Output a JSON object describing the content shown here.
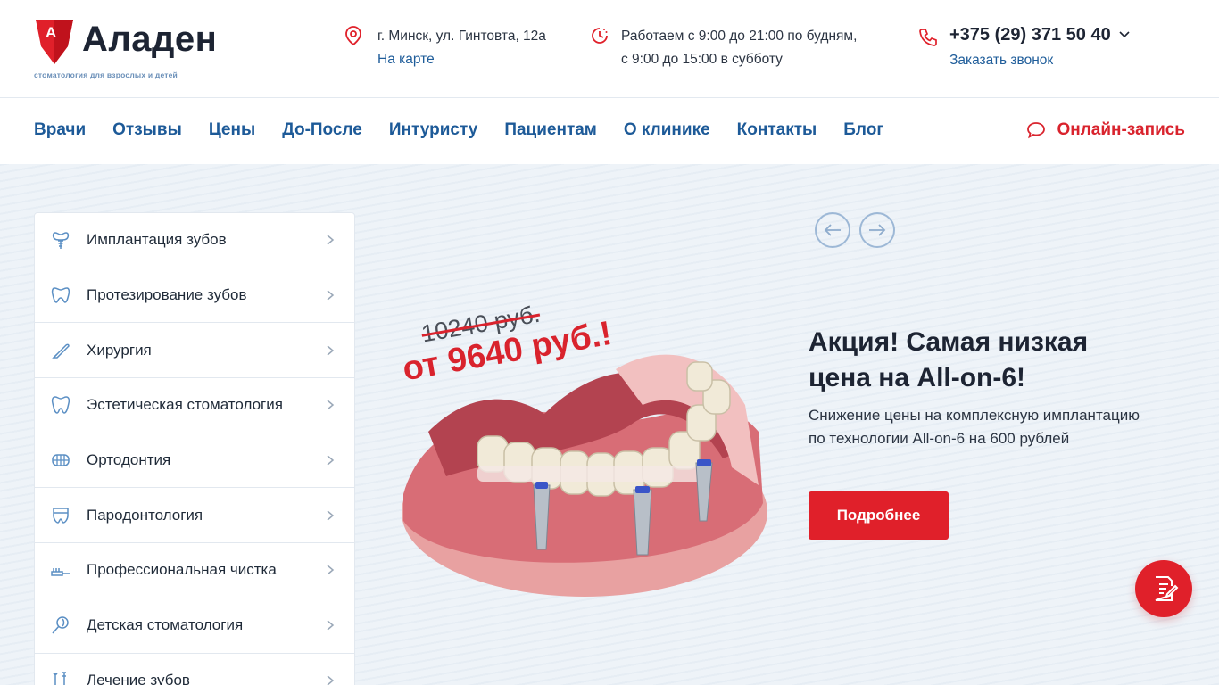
{
  "brand": {
    "name": "Аладен",
    "tagline": "стоматология для взрослых и детей",
    "accent": "#e0202a",
    "link_color": "#1d5a98"
  },
  "header": {
    "address": "г. Минск, ул. Гинтовта, 12а",
    "map_link": "На карте",
    "hours_line1": "Работаем с 9:00 до 21:00 по будням,",
    "hours_line2": "с 9:00 до 15:00 в субботу",
    "phone": "+375 (29) 371 50 40",
    "callback": "Заказать звонок"
  },
  "nav": {
    "items": [
      "Врачи",
      "Отзывы",
      "Цены",
      "До-После",
      "Интуристу",
      "Пациентам",
      "О клинике",
      "Контакты",
      "Блог"
    ],
    "online_booking": "Онлайн-запись"
  },
  "services": [
    {
      "label": "Имплантация зубов",
      "icon": "implant-icon"
    },
    {
      "label": "Протезирование зубов",
      "icon": "crown-icon"
    },
    {
      "label": "Хирургия",
      "icon": "scalpel-icon"
    },
    {
      "label": "Эстетическая стоматология",
      "icon": "tooth-icon"
    },
    {
      "label": "Ортодонтия",
      "icon": "braces-icon"
    },
    {
      "label": "Пародонтология",
      "icon": "gum-icon"
    },
    {
      "label": "Профессиональная чистка",
      "icon": "toothbrush-icon"
    },
    {
      "label": "Детская стоматология",
      "icon": "lollipop-icon"
    },
    {
      "label": "Лечение зубов",
      "icon": "tools-icon"
    }
  ],
  "promo": {
    "old_price": "10240 руб.",
    "new_price": "от 9640 руб.!",
    "title": "Акция! Самая низкая цена на All-on-6!",
    "text": "Снижение цены на комплексную имплантацию по технологии All-on-6 на 600 рублей",
    "button": "Подробнее"
  }
}
